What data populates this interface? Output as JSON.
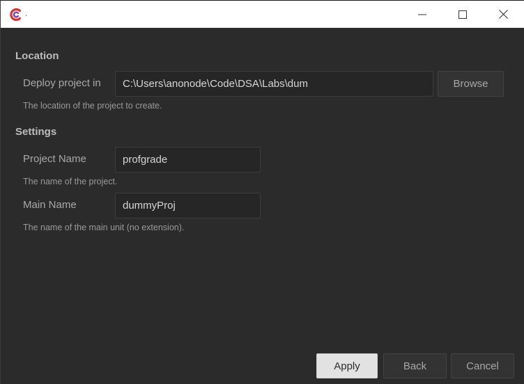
{
  "window": {
    "title": "."
  },
  "icons": {
    "app": "app-logo-icon",
    "minimize": "minimize-icon",
    "maximize": "maximize-icon",
    "close": "close-icon"
  },
  "location": {
    "section_title": "Location",
    "deploy_label": "Deploy project in",
    "deploy_value": "C:\\Users\\anonode\\Code\\DSA\\Labs\\dum",
    "browse_label": "Browse",
    "help": "The location of the project to create."
  },
  "settings": {
    "section_title": "Settings",
    "project_name_label": "Project Name",
    "project_name_value": "profgrade",
    "project_name_help": "The name of the project.",
    "main_name_label": "Main Name",
    "main_name_value": "dummyProj",
    "main_name_help": "The name of the main unit (no extension)."
  },
  "footer": {
    "apply_label": "Apply",
    "back_label": "Back",
    "cancel_label": "Cancel"
  },
  "colors": {
    "background": "#2b2b2b",
    "titlebar": "#ffffff",
    "input_bg": "#262626",
    "accent_red": "#d9342b",
    "accent_purple": "#8a3ab9"
  }
}
